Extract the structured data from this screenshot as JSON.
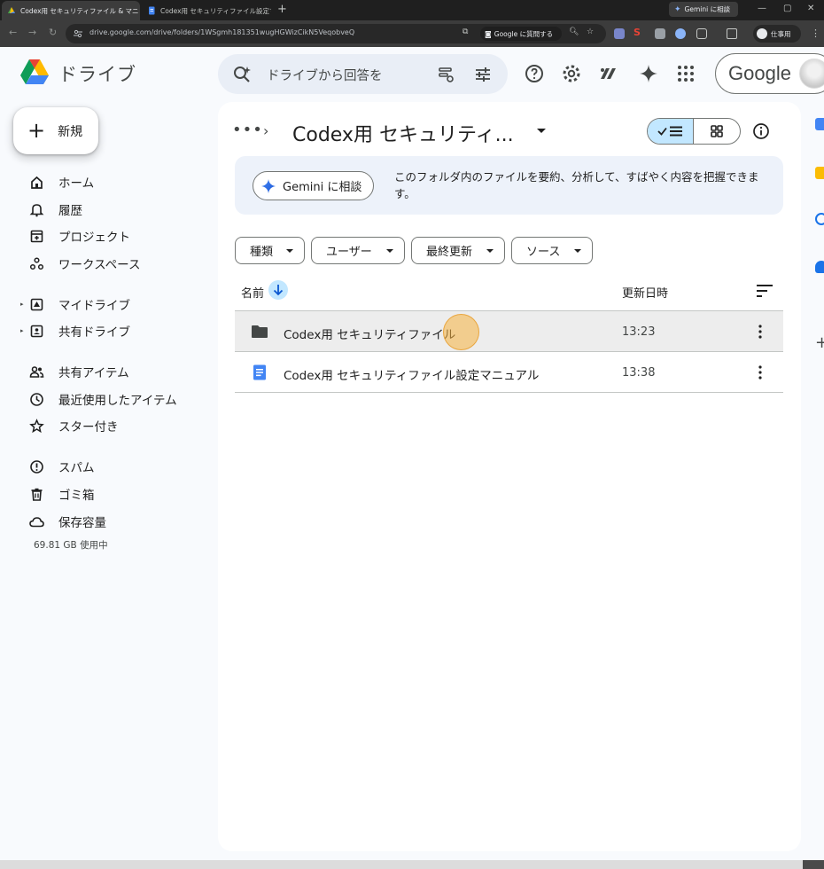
{
  "browser": {
    "tabs": [
      {
        "title": "Codex用 セキュリティファイル & マニ",
        "active": true
      },
      {
        "title": "Codex用 セキュリティファイル設定マ",
        "active": false
      }
    ],
    "gemini_chip": "Gemini に相談",
    "url": "drive.google.com/drive/folders/1WSgmh181351wugHGWizCikN5VeqobveQ",
    "ask_google": "Google に質問する",
    "profile_label": "仕事用"
  },
  "header": {
    "app_title": "ドライブ",
    "search_placeholder": "ドライブから回答を",
    "google_label": "Google"
  },
  "sidebar": {
    "new_label": "新規",
    "items": [
      {
        "label": "ホーム",
        "icon": "home-icon"
      },
      {
        "label": "履歴",
        "icon": "bell-icon"
      },
      {
        "label": "プロジェクト",
        "icon": "project-icon"
      },
      {
        "label": "ワークスペース",
        "icon": "workspace-icon"
      },
      {
        "label": "マイドライブ",
        "icon": "my-drive-icon"
      },
      {
        "label": "共有ドライブ",
        "icon": "shared-drive-icon"
      },
      {
        "label": "共有アイテム",
        "icon": "shared-people-icon"
      },
      {
        "label": "最近使用したアイテム",
        "icon": "clock-icon"
      },
      {
        "label": "スター付き",
        "icon": "star-icon"
      },
      {
        "label": "スパム",
        "icon": "spam-icon"
      },
      {
        "label": "ゴミ箱",
        "icon": "trash-icon"
      },
      {
        "label": "保存容量",
        "icon": "cloud-icon"
      }
    ],
    "storage_used": "69.81 GB 使用中"
  },
  "main": {
    "breadcrumb_more": "•••",
    "current_folder": "Codex用 セキュリティ...",
    "gemini_button": "Gemini に相談",
    "gemini_text": "このフォルダ内のファイルを要約、分析して、すばやく内容を把握できます。",
    "filters": [
      "種類",
      "ユーザー",
      "最終更新",
      "ソース"
    ],
    "columns": {
      "name": "名前",
      "modified": "更新日時"
    },
    "files": [
      {
        "name": "Codex用 セキュリティファイル",
        "modified": "13:23",
        "type": "folder"
      },
      {
        "name": "Codex用 セキュリティファイル設定マニュアル",
        "modified": "13:38",
        "type": "doc"
      }
    ]
  },
  "colors": {
    "accent": "#c2e7ff",
    "doc_blue": "#4285f4",
    "halo": "#f6b240"
  }
}
